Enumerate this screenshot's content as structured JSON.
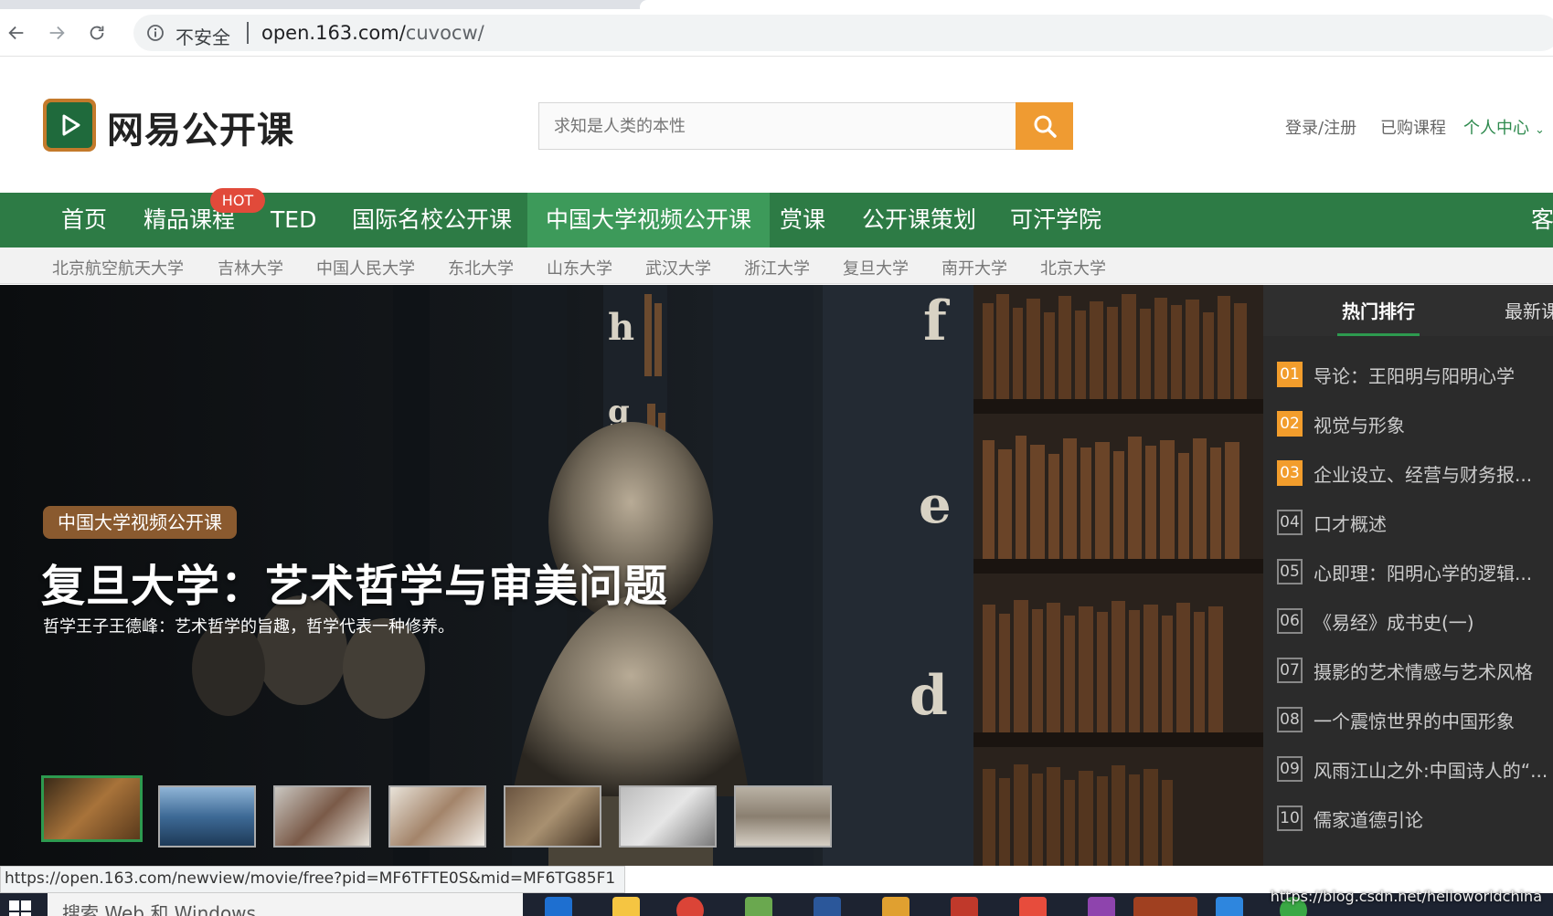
{
  "browser": {
    "insecure_label": "不安全",
    "url_domain": "open.163.com/",
    "url_path": "cuvocw/"
  },
  "header": {
    "logo_text": "网易公开课",
    "search_placeholder": "求知是人类的本性",
    "login": "登录/注册",
    "purchased": "已购课程",
    "personal": "个人中心",
    "accent_color": "#2d7b45",
    "search_color": "#ef9b32"
  },
  "nav": {
    "items": [
      "首页",
      "精品课程",
      "TED",
      "国际名校公开课",
      "中国大学视频公开课",
      "赏课",
      "公开课策划",
      "可汗学院",
      "客"
    ],
    "active": "中国大学视频公开课",
    "hot_badge": "HOT"
  },
  "universities": [
    "北京航空航天大学",
    "吉林大学",
    "中国人民大学",
    "东北大学",
    "山东大学",
    "武汉大学",
    "浙江大学",
    "复旦大学",
    "南开大学",
    "北京大学"
  ],
  "hero": {
    "tag": "中国大学视频公开课",
    "title": "复旦大学：艺术哲学与审美问题",
    "subtitle": "哲学王子王德峰：艺术哲学的旨趣，哲学代表一种修养。",
    "thumbnail_count": 7,
    "active_thumbnail": 1
  },
  "ranking": {
    "tabs": [
      "热门排行",
      "最新课"
    ],
    "items": [
      {
        "num": "01",
        "title": "导论：王阳明与阳明心学"
      },
      {
        "num": "02",
        "title": "视觉与形象"
      },
      {
        "num": "03",
        "title": "企业设立、经营与财务报..."
      },
      {
        "num": "04",
        "title": "口才概述"
      },
      {
        "num": "05",
        "title": "心即理：阳明心学的逻辑..."
      },
      {
        "num": "06",
        "title": "《易经》成书史(一)"
      },
      {
        "num": "07",
        "title": "摄影的艺术情感与艺术风格"
      },
      {
        "num": "08",
        "title": "一个震惊世界的中国形象"
      },
      {
        "num": "09",
        "title": "风雨江山之外:中国诗人的“..."
      },
      {
        "num": "10",
        "title": "儒家道德引论"
      }
    ]
  },
  "status_url": "https://open.163.com/newview/movie/free?pid=MF6TFTE0S&mid=MF6TG85F1",
  "taskbar": {
    "search_text": "搜索 Web 和 Windows"
  },
  "watermark": "https://blog.csdn.net/helloworldchina"
}
